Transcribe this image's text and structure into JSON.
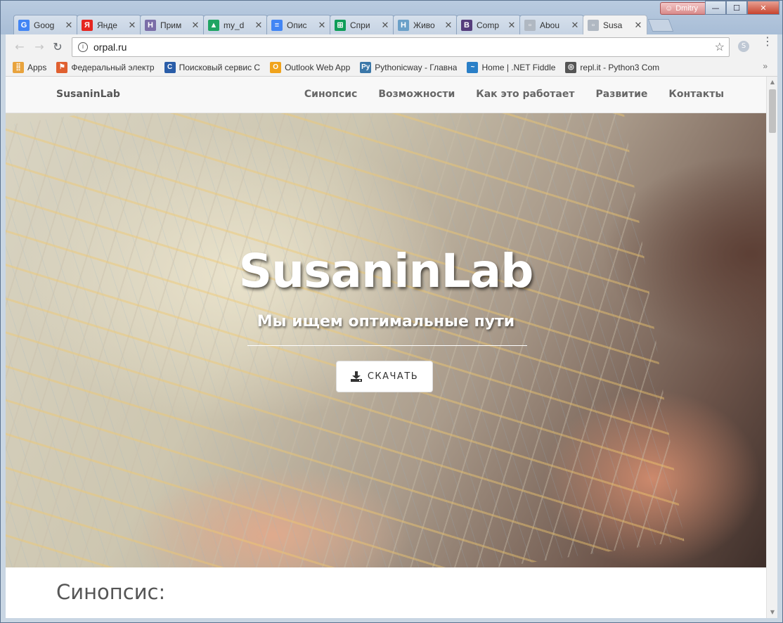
{
  "window": {
    "user": "Dmitry",
    "controls": {
      "minimize": "—",
      "maximize": "☐",
      "close": "✕"
    }
  },
  "tabs": [
    {
      "label": "Goog",
      "icon": "google-icon",
      "color": "#4285f4",
      "glyph": "G"
    },
    {
      "label": "Янде",
      "icon": "yandex-icon",
      "color": "#e52620",
      "glyph": "Я"
    },
    {
      "label": "Прим",
      "icon": "habr-icon",
      "color": "#7b6ea8",
      "glyph": "H"
    },
    {
      "label": "my_d",
      "icon": "google-drive-icon",
      "color": "#1fa463",
      "glyph": "▲"
    },
    {
      "label": "Опис",
      "icon": "google-docs-icon",
      "color": "#4285f4",
      "glyph": "≡"
    },
    {
      "label": "Спри",
      "icon": "google-sheets-icon",
      "color": "#0f9d58",
      "glyph": "⊞"
    },
    {
      "label": "Живо",
      "icon": "site-icon",
      "color": "#6aa0c8",
      "glyph": "H"
    },
    {
      "label": "Comp",
      "icon": "bootstrap-icon",
      "color": "#563d7c",
      "glyph": "B"
    },
    {
      "label": "Abou",
      "icon": "page-icon",
      "color": "#b0b8c2",
      "glyph": "▫"
    },
    {
      "label": "Susa",
      "icon": "page-icon",
      "color": "#b0b8c2",
      "glyph": "▫",
      "active": true
    }
  ],
  "toolbar": {
    "back": "←",
    "forward": "→",
    "reload": "↻",
    "url": "orpal.ru",
    "info_icon": "i",
    "star": "☆",
    "ext_glyph": "S",
    "menu": "⋮"
  },
  "bookmarks": [
    {
      "label": "Apps",
      "icon": "apps-icon",
      "color": "#e8a33d",
      "glyph": "⣿"
    },
    {
      "label": "Федеральный электр",
      "icon": "gov-icon",
      "color": "#e06030",
      "glyph": "⚑"
    },
    {
      "label": "Поисковый сервис С",
      "icon": "search-service-icon",
      "color": "#2a5da8",
      "glyph": "C"
    },
    {
      "label": "Outlook Web App",
      "icon": "outlook-icon",
      "color": "#f0a31c",
      "glyph": "O"
    },
    {
      "label": "Pythonicway - Главна",
      "icon": "python-icon",
      "color": "#3b77a8",
      "glyph": "Py"
    },
    {
      "label": "Home | .NET Fiddle",
      "icon": "dotnetfiddle-icon",
      "color": "#2a7fc7",
      "glyph": "~"
    },
    {
      "label": "repl.it - Python3 Com",
      "icon": "replit-icon",
      "color": "#555555",
      "glyph": "◎"
    }
  ],
  "bookmarks_more": "»",
  "site": {
    "brand": "SusaninLab",
    "nav": [
      "Синопсис",
      "Возможности",
      "Как это работает",
      "Развитие",
      "Контакты"
    ],
    "hero_title": "SusaninLab",
    "hero_subtitle": "Мы ищем оптимальные пути",
    "download_label": "СКАЧАТЬ",
    "section_title": "Синопсис:"
  },
  "scroll": {
    "up": "▲",
    "down": "▼"
  }
}
